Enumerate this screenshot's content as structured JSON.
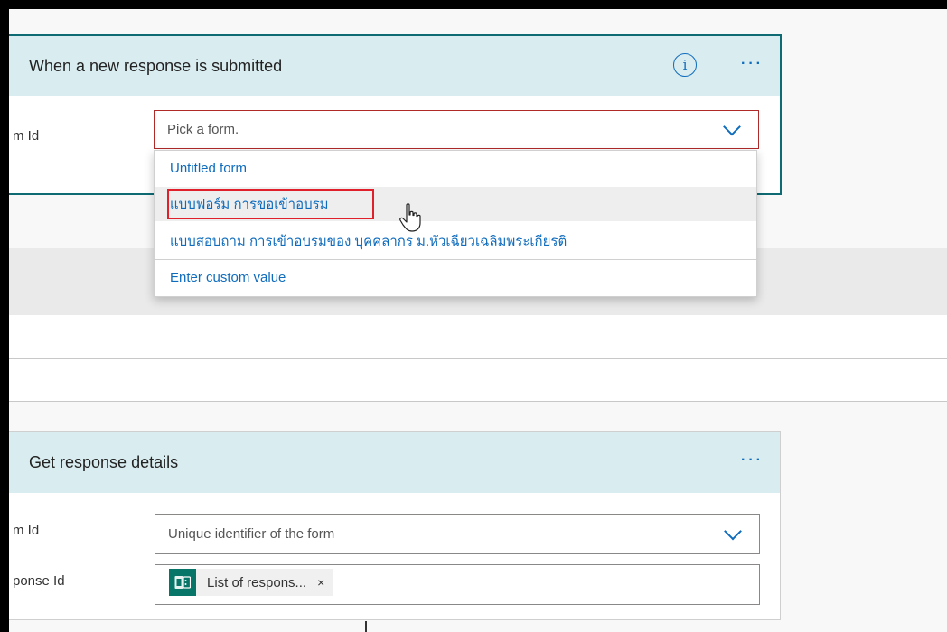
{
  "trigger_card": {
    "title": "When a new response is submitted",
    "info_icon": "info-icon",
    "more_icon": "more-icon",
    "field_label": "m Id",
    "field_placeholder": "Pick a form.",
    "dropdown_items": [
      "Untitled form",
      "แบบฟอร์ม การขอเข้าอบรม",
      "แบบสอบถาม การเข้าอบรมของ บุคคลากร ม.หัวเฉียวเฉลิมพระเกียรติ",
      "Enter custom value"
    ]
  },
  "action_card": {
    "title": "Get response details",
    "more_icon": "more-icon",
    "form_id_label": "m Id",
    "form_id_placeholder": "Unique identifier of the form",
    "response_id_label": "ponse Id",
    "chip_label": "List of respons...",
    "chip_close": "×",
    "chip_icon": "forms-icon"
  },
  "colors": {
    "header_bg": "#d9ecef",
    "accent": "#0f6cbd",
    "error_border": "#b02a2a",
    "highlight": "#e0202a",
    "chip_icon_bg": "#077568"
  }
}
